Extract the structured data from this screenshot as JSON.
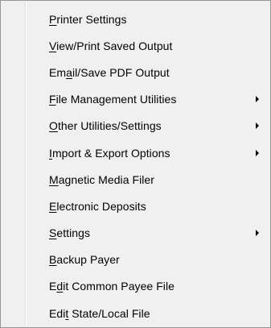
{
  "menu": {
    "items": [
      {
        "pre": "",
        "key": "P",
        "post": "rinter Settings",
        "submenu": false
      },
      {
        "pre": "",
        "key": "V",
        "post": "iew/Print Saved Output",
        "submenu": false
      },
      {
        "pre": "Em",
        "key": "a",
        "post": "il/Save PDF Output",
        "submenu": false
      },
      {
        "pre": "",
        "key": "F",
        "post": "ile Management Utilities",
        "submenu": true
      },
      {
        "pre": "",
        "key": "O",
        "post": "ther Utilities/Settings",
        "submenu": true
      },
      {
        "pre": "",
        "key": "I",
        "post": "mport & Export Options",
        "submenu": true
      },
      {
        "pre": "",
        "key": "M",
        "post": "agnetic Media Filer",
        "submenu": false
      },
      {
        "pre": "",
        "key": "E",
        "post": "lectronic Deposits",
        "submenu": false
      },
      {
        "pre": "",
        "key": "S",
        "post": "ettings",
        "submenu": true
      },
      {
        "pre": "",
        "key": "B",
        "post": "ackup Payer",
        "submenu": false
      },
      {
        "pre": "E",
        "key": "d",
        "post": "it Common Payee File",
        "submenu": false
      },
      {
        "pre": "Edi",
        "key": "t",
        "post": " State/Local File",
        "submenu": false
      }
    ]
  },
  "colors": {
    "menu_background": "#f0f0f0",
    "border": "#979797",
    "text": "#000000"
  }
}
